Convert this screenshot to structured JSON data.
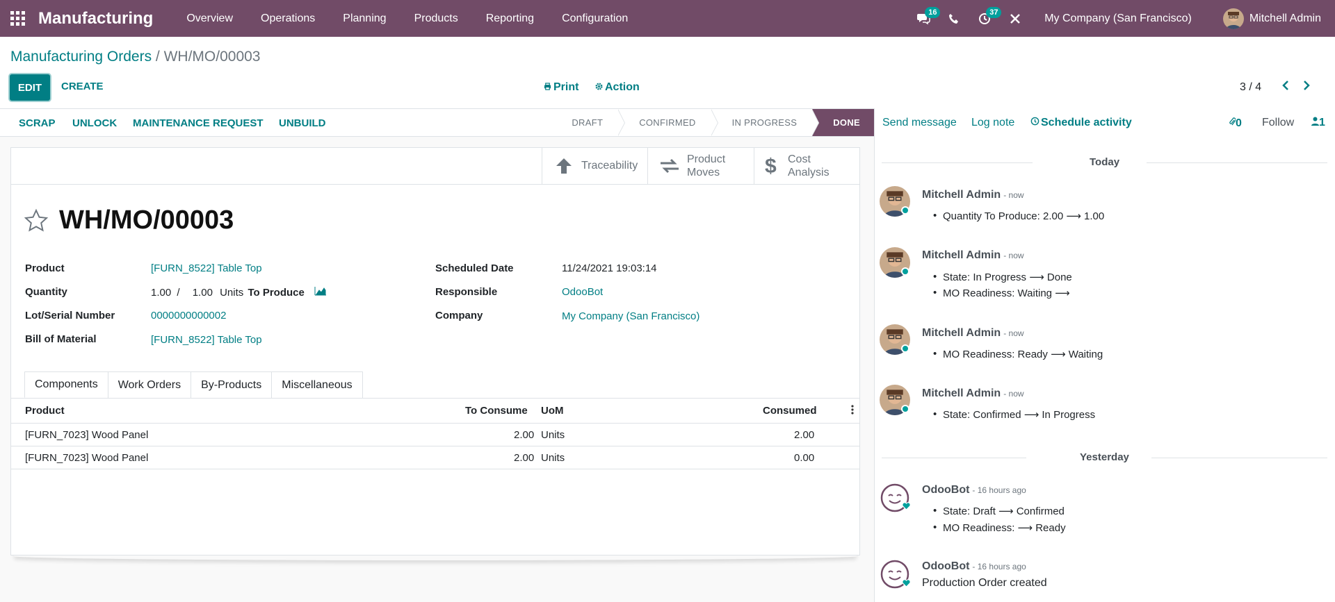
{
  "navbar": {
    "app_title": "Manufacturing",
    "menu": [
      "Overview",
      "Operations",
      "Planning",
      "Products",
      "Reporting",
      "Configuration"
    ],
    "messages_count": "16",
    "activities_count": "37",
    "company": "My Company (San Francisco)",
    "user": "Mitchell Admin"
  },
  "breadcrumb": {
    "parent": "Manufacturing Orders",
    "separator": " / ",
    "current": "WH/MO/00003"
  },
  "control": {
    "edit": "EDIT",
    "create": "CREATE",
    "print": "Print",
    "action": "Action",
    "pager": "3 / 4"
  },
  "statusbar": {
    "buttons": [
      "SCRAP",
      "UNLOCK",
      "MAINTENANCE REQUEST",
      "UNBUILD"
    ],
    "stages": [
      "DRAFT",
      "CONFIRMED",
      "IN PROGRESS",
      "DONE"
    ],
    "active_stage": "DONE"
  },
  "smart_buttons": {
    "traceability": "Traceability",
    "product_moves_1": "Product",
    "product_moves_2": "Moves",
    "cost_1": "Cost",
    "cost_2": "Analysis"
  },
  "record": {
    "name": "WH/MO/00003",
    "labels": {
      "product": "Product",
      "quantity": "Quantity",
      "lot": "Lot/Serial Number",
      "bom": "Bill of Material",
      "scheduled": "Scheduled Date",
      "responsible": "Responsible",
      "company": "Company"
    },
    "product": "[FURN_8522] Table Top",
    "qty_produced": "1.00",
    "qty_slash": "/",
    "qty_total": "1.00",
    "qty_uom": "Units",
    "qty_to_produce": "To Produce",
    "lot": "0000000000002",
    "bom": "[FURN_8522] Table Top",
    "scheduled": "11/24/2021 19:03:14",
    "responsible": "OdooBot",
    "company": "My Company (San Francisco)"
  },
  "tabs": [
    "Components",
    "Work Orders",
    "By-Products",
    "Miscellaneous"
  ],
  "components": {
    "headers": {
      "product": "Product",
      "to_consume": "To Consume",
      "uom": "UoM",
      "consumed": "Consumed"
    },
    "rows": [
      {
        "product": "[FURN_7023] Wood Panel",
        "to_consume": "2.00",
        "uom": "Units",
        "consumed": "2.00"
      },
      {
        "product": "[FURN_7023] Wood Panel",
        "to_consume": "2.00",
        "uom": "Units",
        "consumed": "0.00"
      }
    ]
  },
  "chatter": {
    "send_message": "Send message",
    "log_note": "Log note",
    "schedule_activity": "Schedule activity",
    "attachments": "0",
    "follow": "Follow",
    "followers": "1",
    "today": "Today",
    "yesterday": "Yesterday",
    "messages": [
      {
        "author": "Mitchell Admin",
        "time": "- now",
        "lines": [
          "Quantity To Produce: 2.00 ⟶ 1.00"
        ]
      },
      {
        "author": "Mitchell Admin",
        "time": "- now",
        "lines": [
          "State: In Progress ⟶ Done",
          "MO Readiness: Waiting ⟶"
        ]
      },
      {
        "author": "Mitchell Admin",
        "time": "- now",
        "lines": [
          "MO Readiness: Ready ⟶ Waiting"
        ]
      },
      {
        "author": "Mitchell Admin",
        "time": "- now",
        "lines": [
          "State: Confirmed ⟶ In Progress"
        ]
      },
      {
        "author": "OdooBot",
        "time": "- 16 hours ago",
        "lines": [
          "State: Draft ⟶ Confirmed",
          "MO Readiness: ⟶ Ready"
        ]
      },
      {
        "author": "OdooBot",
        "time": "- 16 hours ago",
        "text": "Production Order created"
      }
    ]
  },
  "colors": {
    "brand": "#714b67",
    "accent": "#017e84",
    "teal": "#00a09d"
  }
}
